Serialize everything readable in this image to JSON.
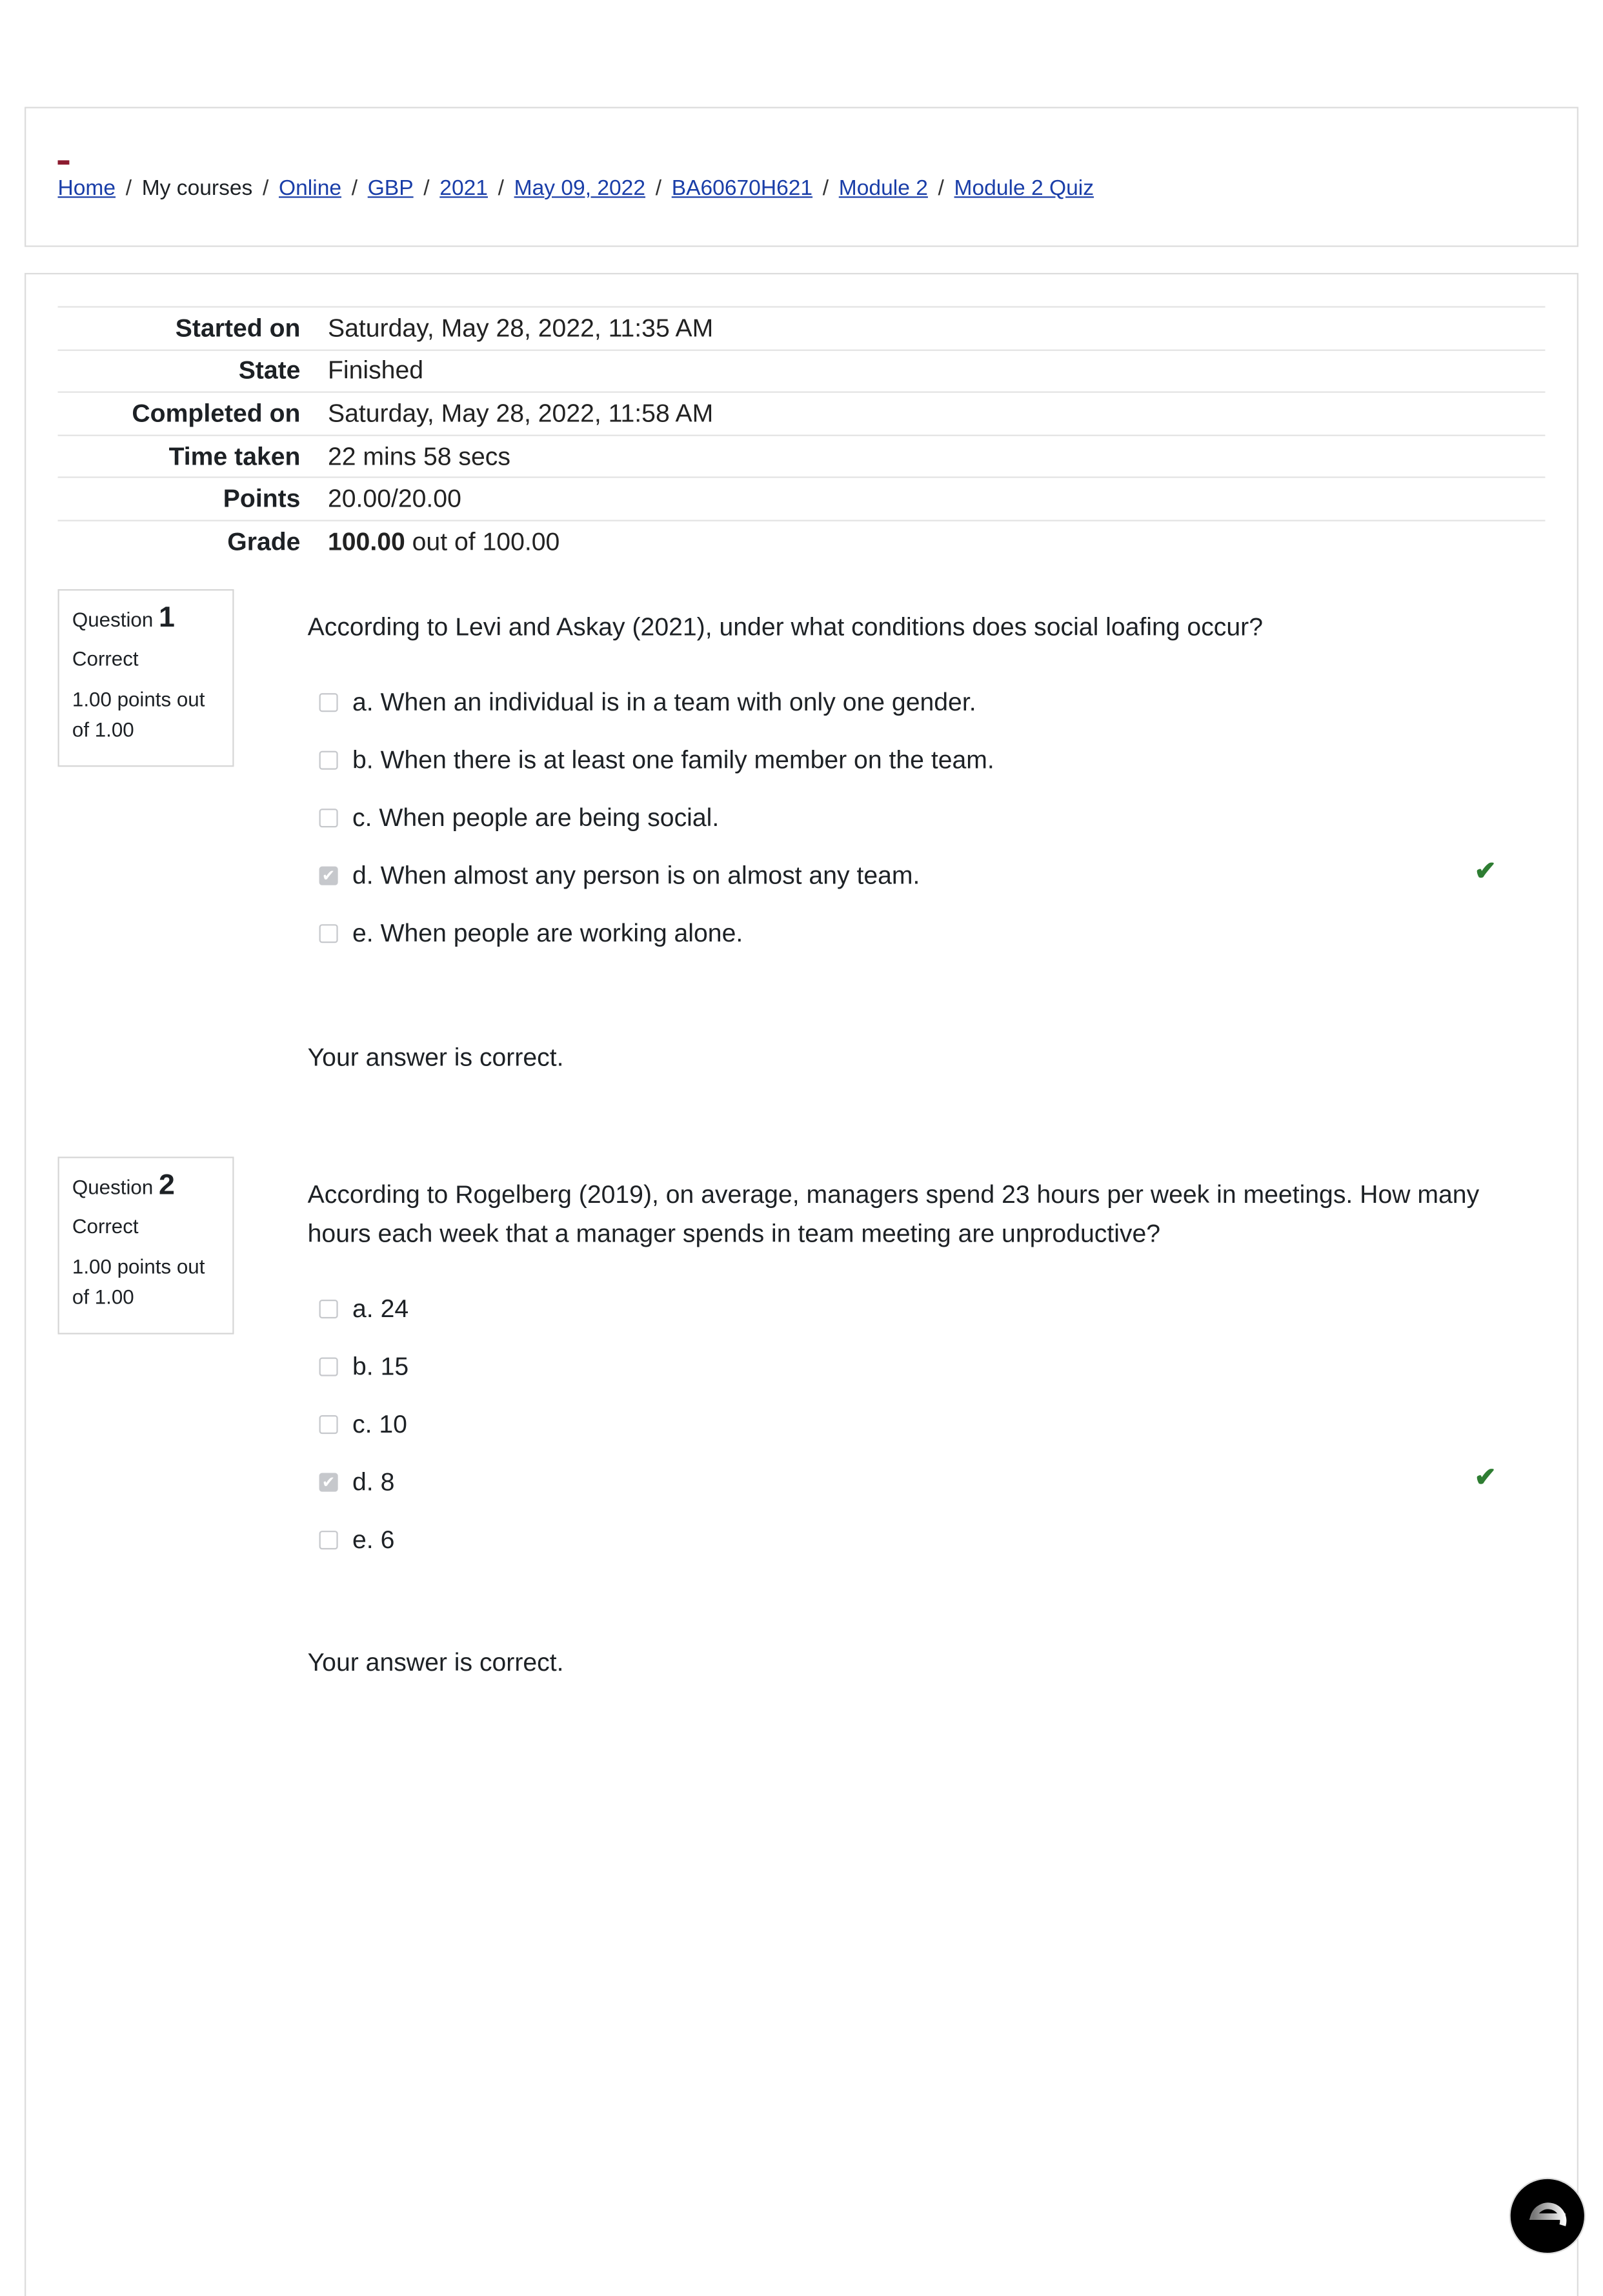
{
  "breadcrumb": [
    "Home",
    "My courses",
    "Online",
    "GBP",
    "2021",
    "May 09, 2022",
    "BA60670H621",
    "Module 2",
    "Module 2 Quiz"
  ],
  "breadcrumb_links": [
    true,
    false,
    true,
    true,
    true,
    true,
    true,
    true,
    true
  ],
  "summary": [
    {
      "label": "Started on",
      "value": "Saturday, May 28, 2022, 11:35 AM"
    },
    {
      "label": "State",
      "value": "Finished"
    },
    {
      "label": "Completed on",
      "value": "Saturday, May 28, 2022, 11:58 AM"
    },
    {
      "label": "Time taken",
      "value": "22 mins 58 secs"
    },
    {
      "label": "Points",
      "value": "20.00/20.00"
    },
    {
      "label": "Grade",
      "value_bold": "100.00",
      "value": " out of 100.00"
    }
  ],
  "questions": [
    {
      "label": "Question",
      "number": "1",
      "state": "Correct",
      "grade": "1.00 points out of 1.00",
      "text": "According to Levi and Askay (2021), under what conditions does social loafing occur?",
      "options": [
        {
          "text": "a. When an individual is in a team with only one gender.",
          "checked": false
        },
        {
          "text": "b. When there is at least one family member on the team.",
          "checked": false
        },
        {
          "text": "c. When people are being social.",
          "checked": false
        },
        {
          "text": "d. When almost any person is on almost any team.",
          "checked": true,
          "correct": true
        },
        {
          "text": "e. When people are working alone.",
          "checked": false
        }
      ],
      "feedback": "Your answer is correct."
    },
    {
      "label": "Question",
      "number": "2",
      "state": "Correct",
      "grade": "1.00 points out of 1.00",
      "text": "According to Rogelberg (2019), on average, managers spend 23 hours per week in meetings.  How many hours each week that a manager spends in team meeting are unproductive?",
      "options": [
        {
          "text": "a. 24",
          "checked": false
        },
        {
          "text": "b. 15",
          "checked": false
        },
        {
          "text": "c. 10",
          "checked": false
        },
        {
          "text": "d. 8",
          "checked": true,
          "correct": true
        },
        {
          "text": "e. 6",
          "checked": false
        }
      ],
      "feedback": "Your answer is correct."
    }
  ],
  "colors": {
    "link": "#1a3ea8",
    "correct": "#2e7d32",
    "brand": "#8c1b2f"
  },
  "icons": {
    "correct": "check-icon",
    "logo": "e-logo-icon"
  }
}
